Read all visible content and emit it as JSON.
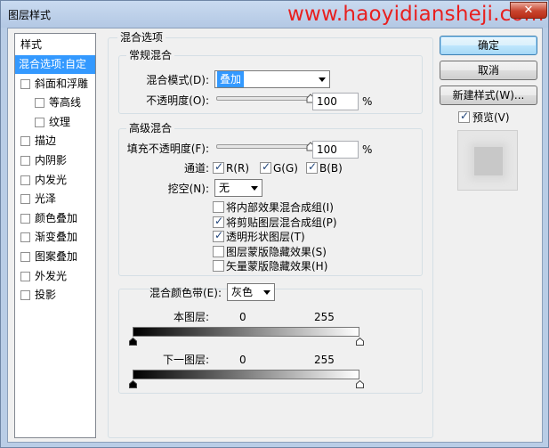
{
  "window": {
    "title": "图层样式",
    "watermark": "www.haoyidiansheji.com",
    "close_glyph": "✕"
  },
  "style_list": {
    "header": "样式",
    "items": [
      {
        "label": "混合选项:自定",
        "selected": true,
        "checkbox": false,
        "indent": 0
      },
      {
        "label": "斜面和浮雕",
        "selected": false,
        "checkbox": true,
        "checked": false,
        "indent": 0
      },
      {
        "label": "等高线",
        "selected": false,
        "checkbox": true,
        "checked": false,
        "indent": 1
      },
      {
        "label": "纹理",
        "selected": false,
        "checkbox": true,
        "checked": false,
        "indent": 1
      },
      {
        "label": "描边",
        "selected": false,
        "checkbox": true,
        "checked": false,
        "indent": 0
      },
      {
        "label": "内阴影",
        "selected": false,
        "checkbox": true,
        "checked": false,
        "indent": 0
      },
      {
        "label": "内发光",
        "selected": false,
        "checkbox": true,
        "checked": false,
        "indent": 0
      },
      {
        "label": "光泽",
        "selected": false,
        "checkbox": true,
        "checked": false,
        "indent": 0
      },
      {
        "label": "颜色叠加",
        "selected": false,
        "checkbox": true,
        "checked": false,
        "indent": 0
      },
      {
        "label": "渐变叠加",
        "selected": false,
        "checkbox": true,
        "checked": false,
        "indent": 0
      },
      {
        "label": "图案叠加",
        "selected": false,
        "checkbox": true,
        "checked": false,
        "indent": 0
      },
      {
        "label": "外发光",
        "selected": false,
        "checkbox": true,
        "checked": false,
        "indent": 0
      },
      {
        "label": "投影",
        "selected": false,
        "checkbox": true,
        "checked": false,
        "indent": 0
      }
    ]
  },
  "blending_options": {
    "title": "混合选项",
    "general": {
      "title": "常规混合",
      "mode_label": "混合模式(D):",
      "mode_value": "叠加",
      "opacity_label": "不透明度(O):",
      "opacity_value": "100",
      "opacity_fraction": 1.0,
      "percent": "%"
    },
    "advanced": {
      "title": "高级混合",
      "fill_label": "填充不透明度(F):",
      "fill_value": "100",
      "fill_fraction": 1.0,
      "percent": "%",
      "channels_label": "通道:",
      "channel_r": "R(R)",
      "channel_g": "G(G)",
      "channel_b": "B(B)",
      "knockout_label": "挖空(N):",
      "knockout_value": "无",
      "options": [
        {
          "label": "将内部效果混合成组(I)",
          "checked": false
        },
        {
          "label": "将剪贴图层混合成组(P)",
          "checked": true
        },
        {
          "label": "透明形状图层(T)",
          "checked": true
        },
        {
          "label": "图层蒙版隐藏效果(S)",
          "checked": false
        },
        {
          "label": "矢量蒙版隐藏效果(H)",
          "checked": false
        }
      ]
    },
    "blend_if": {
      "label": "混合颜色带(E):",
      "value": "灰色",
      "this_layer_label": "本图层:",
      "this_layer_min": "0",
      "this_layer_max": "255",
      "underlying_label": "下一图层:",
      "underlying_min": "0",
      "underlying_max": "255"
    }
  },
  "buttons": {
    "ok": "确定",
    "cancel": "取消",
    "new_style": "新建样式(W)...",
    "preview_label": "预览(V)",
    "preview_checked": true
  }
}
